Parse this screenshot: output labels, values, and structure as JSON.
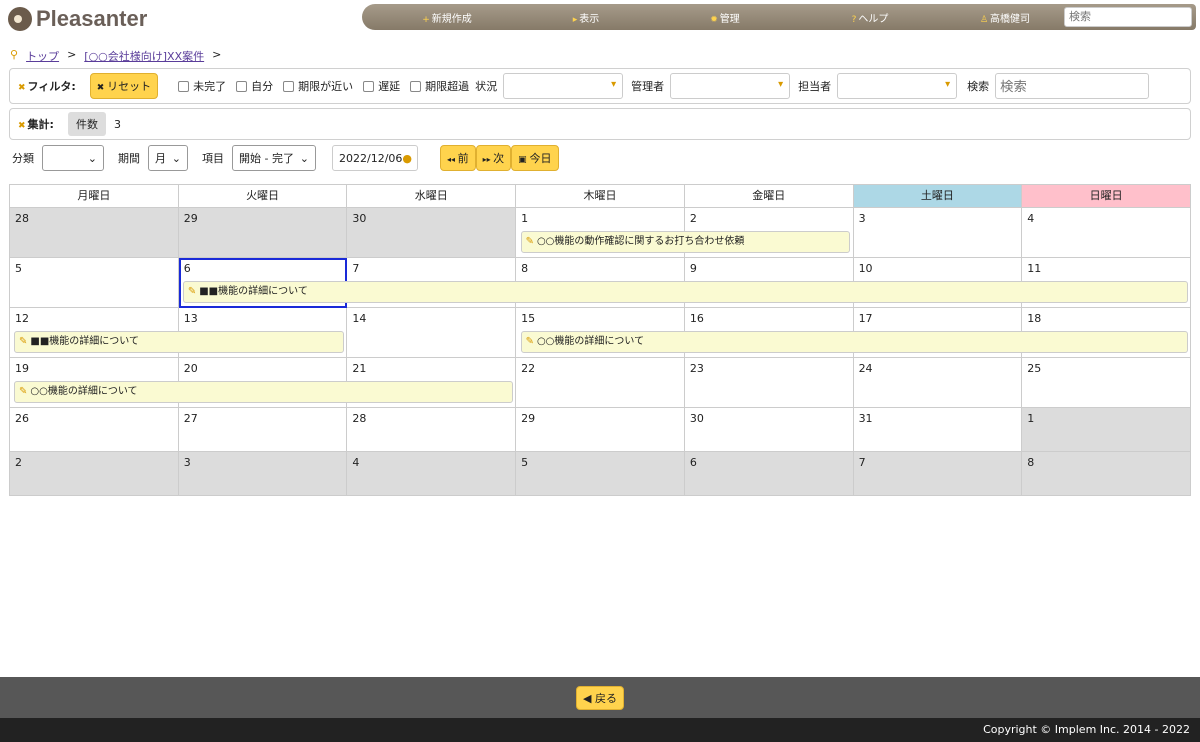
{
  "logo": "Pleasanter",
  "nav": {
    "items": [
      {
        "icon": "+",
        "label": "新規作成"
      },
      {
        "icon": "▸",
        "label": "表示"
      },
      {
        "icon": "✹",
        "label": "管理"
      },
      {
        "icon": "?",
        "label": "ヘルプ"
      },
      {
        "icon": "♙",
        "label": "高橋健司"
      }
    ],
    "search_placeholder": "検索"
  },
  "breadcrumb": [
    "トップ",
    "[○○会社様向け]XX案件"
  ],
  "filter": {
    "label": "フィルタ:",
    "reset": "リセット",
    "checks": [
      "未完了",
      "自分",
      "期限が近い",
      "遅延",
      "期限超過"
    ],
    "status_label": "状況",
    "manager_label": "管理者",
    "owner_label": "担当者",
    "search_label": "検索",
    "search_placeholder": "検索"
  },
  "aggregate": {
    "label": "集計:",
    "type": "件数",
    "value": "3"
  },
  "tools": {
    "class_label": "分類",
    "period_label": "期間",
    "period_value": "月",
    "item_label": "項目",
    "item_value": "開始 - 完了",
    "date": "2022/12/06",
    "prev": "前",
    "next": "次",
    "today": "今日"
  },
  "calendar": {
    "weekdays": [
      "月曜日",
      "火曜日",
      "水曜日",
      "木曜日",
      "金曜日",
      "土曜日",
      "日曜日"
    ],
    "weeks": [
      {
        "days": [
          "28",
          "29",
          "30",
          "1",
          "2",
          "3",
          "4"
        ],
        "gray": [
          0,
          1,
          2
        ],
        "events": [
          {
            "title": "○○機能の動作確認に関するお打ち合わせ依頼",
            "start": 3,
            "span": 2
          }
        ]
      },
      {
        "days": [
          "5",
          "6",
          "7",
          "8",
          "9",
          "10",
          "11"
        ],
        "gray": [],
        "selected": 1,
        "events": [
          {
            "title": "■■機能の詳細について",
            "start": 1,
            "span": 6
          }
        ]
      },
      {
        "days": [
          "12",
          "13",
          "14",
          "15",
          "16",
          "17",
          "18"
        ],
        "gray": [],
        "events": [
          {
            "title": "■■機能の詳細について",
            "start": 0,
            "span": 2
          },
          {
            "title": "○○機能の詳細について",
            "start": 3,
            "span": 4
          }
        ]
      },
      {
        "days": [
          "19",
          "20",
          "21",
          "22",
          "23",
          "24",
          "25"
        ],
        "gray": [],
        "events": [
          {
            "title": "○○機能の詳細について",
            "start": 0,
            "span": 3
          }
        ]
      },
      {
        "days": [
          "26",
          "27",
          "28",
          "29",
          "30",
          "31",
          "1"
        ],
        "gray": [
          6
        ],
        "events": []
      },
      {
        "days": [
          "2",
          "3",
          "4",
          "5",
          "6",
          "7",
          "8"
        ],
        "gray": [
          0,
          1,
          2,
          3,
          4,
          5,
          6
        ],
        "events": []
      }
    ],
    "colors": {
      "saturday": "#add8e6",
      "sunday": "#ffc0cb"
    }
  },
  "footer": {
    "back": "戻る",
    "copyright": "Copyright © Implem Inc. 2014 - 2022"
  }
}
